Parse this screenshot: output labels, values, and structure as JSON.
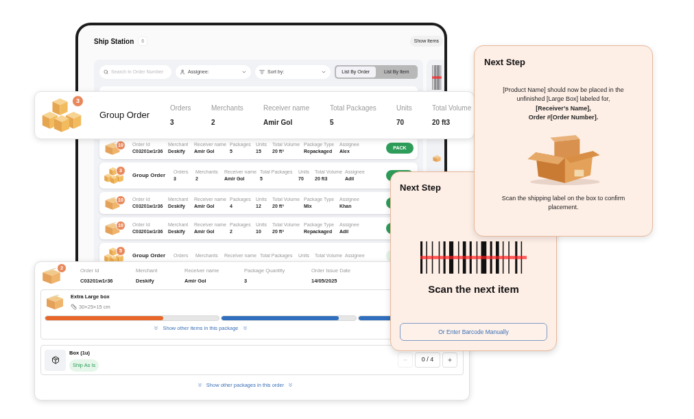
{
  "tablet": {
    "title": "Ship Station",
    "count": "6",
    "show_items": "Show items",
    "search": {
      "placeholder": "Search in Order Number"
    },
    "assignee": "Assignee:",
    "sort": "Sort by:",
    "view_toggle": [
      {
        "label": "List By Order",
        "selected": true
      },
      {
        "label": "List By Item",
        "selected": false
      }
    ],
    "rows": [
      {
        "kind": "order",
        "badge": "10",
        "fields": [
          {
            "label": "Order Id",
            "value": "C03201w1r36"
          },
          {
            "label": "Merchant",
            "value": "Deskify"
          },
          {
            "label": "Receiver name",
            "value": "Amir Gol"
          },
          {
            "label": "Packages",
            "value": "5"
          },
          {
            "label": "Units",
            "value": "15"
          },
          {
            "label": "Total Volume",
            "value": "20 ft³"
          },
          {
            "label": "Package Type",
            "value": "Repackaged"
          },
          {
            "label": "Assignee",
            "value": "Alex"
          }
        ],
        "button": {
          "label": "PACK",
          "muted": false
        }
      },
      {
        "kind": "group",
        "badge": "3",
        "title": "Group Order",
        "fields": [
          {
            "label": "Orders",
            "value": "3"
          },
          {
            "label": "Merchants",
            "value": "2"
          },
          {
            "label": "Receiver name",
            "value": "Amir Gol"
          },
          {
            "label": "Total Packages",
            "value": "5"
          },
          {
            "label": "Units",
            "value": "70"
          },
          {
            "label": "Total Volume",
            "value": "20 ft3"
          },
          {
            "label": "Assignee",
            "value": "Adil"
          }
        ],
        "button": {
          "muted": false
        }
      },
      {
        "kind": "order",
        "badge": "10",
        "fields": [
          {
            "label": "Order Id",
            "value": "C03201w1r36"
          },
          {
            "label": "Merchant",
            "value": "Deskify"
          },
          {
            "label": "Receiver name",
            "value": "Amir Gol"
          },
          {
            "label": "Packages",
            "value": "4"
          },
          {
            "label": "Units",
            "value": "12"
          },
          {
            "label": "Total Volume",
            "value": "20 ft³"
          },
          {
            "label": "Package Type",
            "value": "Mix"
          },
          {
            "label": "Assignee",
            "value": "Khan"
          }
        ],
        "button": {
          "muted": false
        }
      },
      {
        "kind": "order",
        "badge": "10",
        "fields": [
          {
            "label": "Order Id",
            "value": "C03201w1r36"
          },
          {
            "label": "Merchant",
            "value": "Deskify"
          },
          {
            "label": "Receiver name",
            "value": "Amir Gol"
          },
          {
            "label": "Packages",
            "value": "2"
          },
          {
            "label": "Units",
            "value": "10"
          },
          {
            "label": "Total Volume",
            "value": "20 ft³"
          },
          {
            "label": "Package Type",
            "value": "Repackaged"
          },
          {
            "label": "Assignee",
            "value": "Adil"
          }
        ],
        "button": {
          "muted": false
        }
      },
      {
        "kind": "group",
        "badge": "5",
        "title": "Group Order",
        "fields": [
          {
            "label": "Orders"
          },
          {
            "label": "Merchants"
          },
          {
            "label": "Receiver name"
          },
          {
            "label": "Total Packages"
          },
          {
            "label": "Units"
          },
          {
            "label": "Total Volume"
          },
          {
            "label": "Assignee"
          }
        ],
        "button": {
          "muted": true
        }
      }
    ]
  },
  "group_card": {
    "badge": "3",
    "title": "Group Order",
    "fields": [
      {
        "label": "Orders",
        "value": "3"
      },
      {
        "label": "Merchants",
        "value": "2"
      },
      {
        "label": "Receiver name",
        "value": "Amir Gol"
      },
      {
        "label": "Total Packages",
        "value": "5"
      },
      {
        "label": "Units",
        "value": "70"
      },
      {
        "label": "Total Volume",
        "value": "20 ft3"
      }
    ]
  },
  "detail": {
    "badge": "2",
    "fields": [
      {
        "label": "Order Id",
        "value": "C03201w1r36"
      },
      {
        "label": "Merchant",
        "value": "Deskify"
      },
      {
        "label": "Receiver name",
        "value": "Amir Gol"
      },
      {
        "label": "Package Quantity",
        "value": "3"
      },
      {
        "label": "Order Issue Date",
        "value": "14/05/2025"
      }
    ],
    "package": {
      "name": "Extra Large box",
      "size": "30×25×15 cm",
      "bars": [
        {
          "level": 0.68,
          "color": "#e8662a"
        },
        {
          "level": 0.87,
          "color": "#2f6fbd"
        },
        {
          "level": 1,
          "color": "#2f6fbd"
        }
      ],
      "link": "Show other items in this package"
    },
    "item": {
      "name": "Box (1u)",
      "tag": "Ship As Is",
      "count": "0 / 4",
      "decrement_disabled": true
    },
    "link": "Show other packages in this order"
  },
  "instructions": {
    "title": "Next Step",
    "message": "[Product Name] should now be placed in the unfinished [Large Box] labeled for,\n**[Receiver’s Name],**\n**Order #[Order Number].**",
    "note": "Scan the shipping label on the box to confirm placement."
  },
  "scan": {
    "title": "Next Step",
    "prompt": "Scan the next item",
    "button": "Or Enter Barcode Manually"
  }
}
